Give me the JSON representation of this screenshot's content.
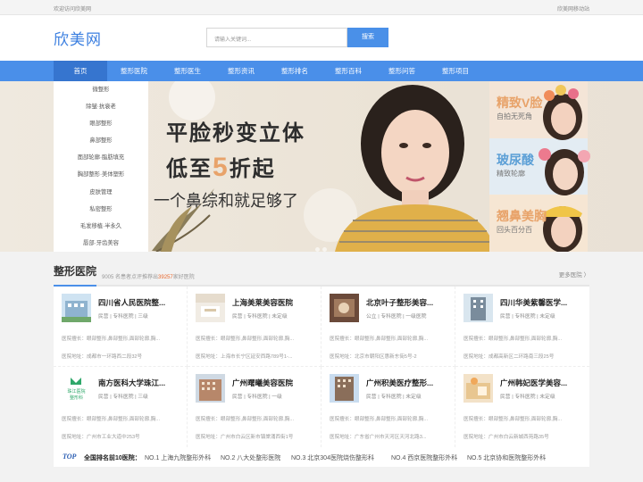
{
  "topbar": {
    "welcome": "欢迎访问欣美网",
    "mobile": "欣美网移动站"
  },
  "header": {
    "logo": "欣美网",
    "search_placeholder": "请输入关键词...",
    "search_button": "搜索"
  },
  "nav": [
    "首页",
    "整形医院",
    "整形医生",
    "整形资讯",
    "整形排名",
    "整形百科",
    "整形问答",
    "整形项目"
  ],
  "side_menu": [
    "微整形",
    "除皱·抗衰老",
    "眼部整形",
    "鼻部整形",
    "面部轮廓·脂肪填充",
    "胸部整形·美体塑形",
    "皮肤管理",
    "私密整形",
    "毛发移植·半永久",
    "唇部·牙齿美容"
  ],
  "banner": {
    "headline": "平脸秒变立体",
    "sub_prefix": "低至",
    "sub_num": "5",
    "sub_suffix": "折起",
    "line": "一个鼻综和就足够了",
    "cards": [
      {
        "title": "精致V脸",
        "sub": "自拍无死角",
        "color": "#e8a36a"
      },
      {
        "title": "玻尿酸",
        "sub": "精致轮廓",
        "color": "#5b9fd6"
      },
      {
        "title": "翘鼻美胸",
        "sub": "回头百分百",
        "color": "#e8a36a"
      }
    ]
  },
  "section": {
    "title": "整形医院",
    "sub_a": "9005",
    "sub_b": "名患者点评推荐出",
    "sub_c": "39257",
    "sub_d": "家好医院",
    "more": "更多医院 〉"
  },
  "hospitals": [
    {
      "name": "四川省人民医院整...",
      "tags": "民营 | 专科医院 | 三级",
      "line1": "医院擅长：眼部整形,鼻部整形,面部轮廓,胸...",
      "line2": "医院地址：成都市一环路西二段32号"
    },
    {
      "name": "上海美莱美容医院",
      "tags": "民营 | 专科医院 | 未定级",
      "line1": "医院擅长：眼部整形,鼻部整形,面部轮廓,胸...",
      "line2": "医院地址：上海市长宁区延安西路789号1-..."
    },
    {
      "name": "北京叶子整形美容...",
      "tags": "公立 | 专科医院 | 一级医院",
      "line1": "医院擅长：眼部整形,鼻部整形,面部轮廓,胸...",
      "line2": "医院地址：北京市朝阳区惠新东街5号-2"
    },
    {
      "name": "四川华美紫馨医学...",
      "tags": "民营 | 专科医院 | 未定级",
      "line1": "医院擅长：眼部整形,鼻部整形,面部轮廓,胸...",
      "line2": "医院地址：成都高新区二环路南三段25号"
    },
    {
      "name": "南方医科大学珠江...",
      "tags": "民营 | 专科医院 | 三级",
      "line1": "医院擅长：眼部整形,鼻部整形,面部轮廓,胸...",
      "line2": "医院地址：广州市工业大道中253号"
    },
    {
      "name": "广州曙曦美容医院",
      "tags": "民营 | 专科医院 | 一级",
      "line1": "医院擅长：眼部整形,鼻部整形,面部轮廓,胸...",
      "line2": "医院地址：广州市白云区新市镇棠涌西街1号"
    },
    {
      "name": "广州积美医疗整形...",
      "tags": "民营 | 专科医院 | 未定级",
      "line1": "医院擅长：眼部整形,鼻部整形,面部轮廓,胸...",
      "line2": "医院地址：广东省广州市天河区天河北路3..."
    },
    {
      "name": "广州韩妃医学美容...",
      "tags": "民营 | 专科医院 | 未定级",
      "line1": "医院擅长：眼部整形,鼻部整形,面部轮廓,胸...",
      "line2": "医院地址：广州市白云新城西苑路35号"
    }
  ],
  "hospital_thumb_text": {
    "nanfang": "珠江医院\n整形科"
  },
  "ranking": {
    "top_badge": "TOP",
    "label": "全国排名前10医院：",
    "items": [
      "NO.1 上海九院整形外科",
      "NO.2 八大处整形医院",
      "NO.3 北京304医院烧伤整形科",
      "NO.4 西京医院整形外科",
      "NO.5 北京协和医院整形外科"
    ]
  },
  "colors": {
    "brand": "#4a8fe9",
    "accent": "#e8a36a"
  }
}
